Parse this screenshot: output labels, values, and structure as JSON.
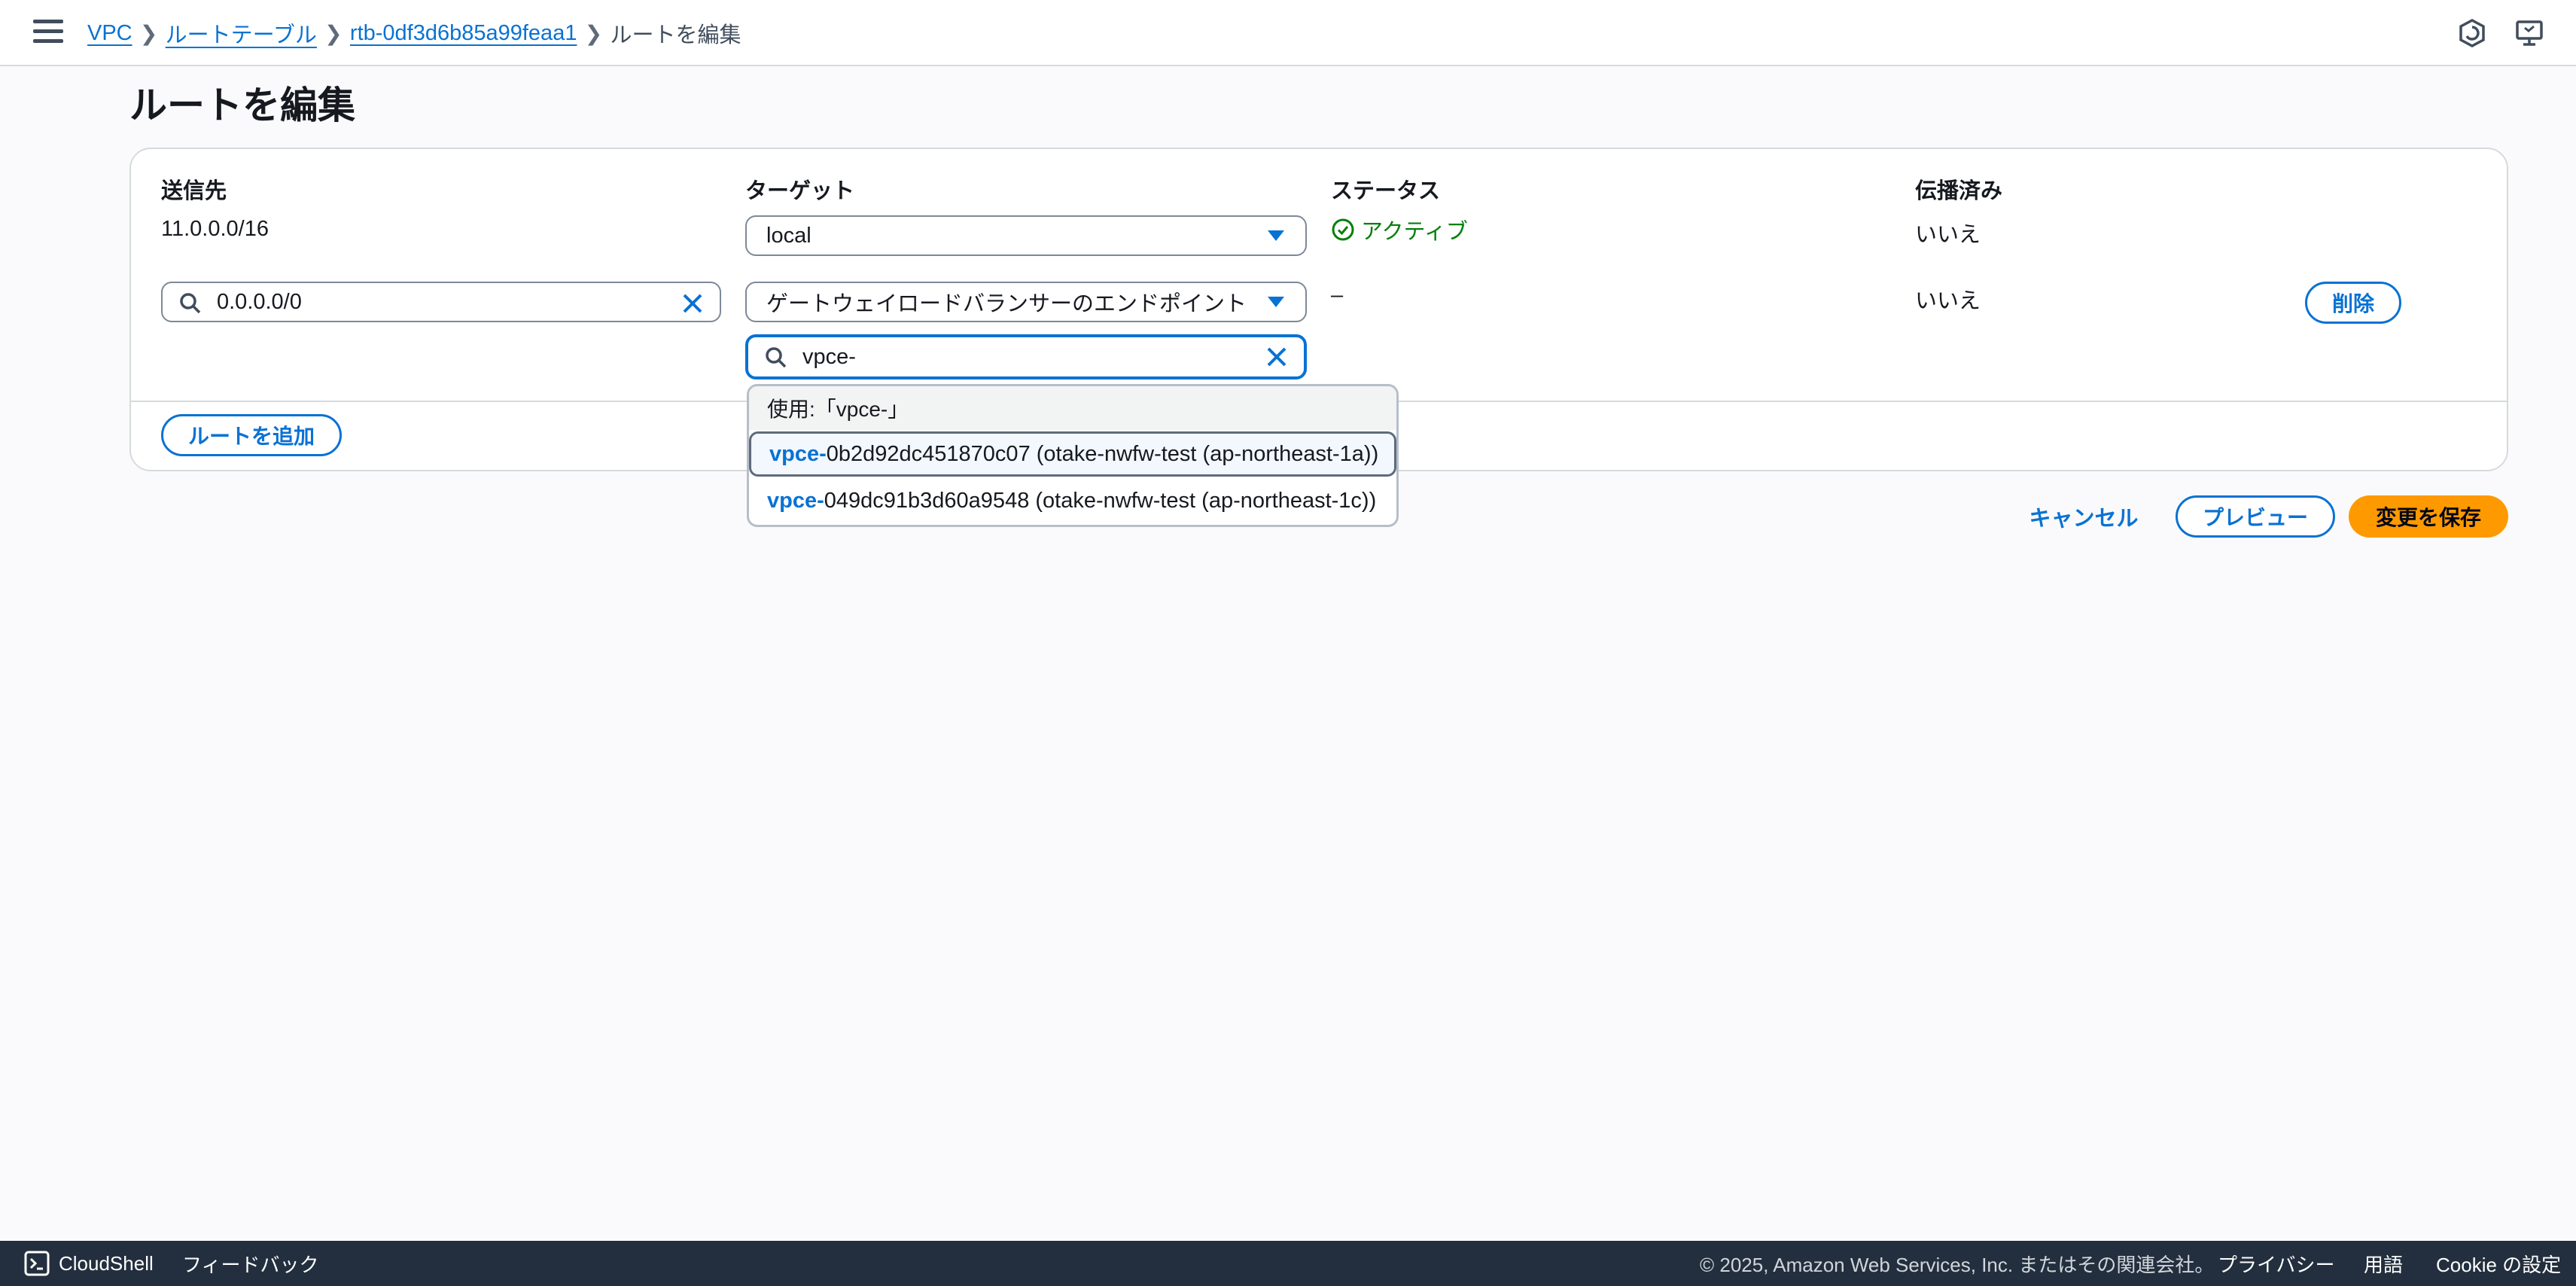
{
  "breadcrumb": {
    "items": [
      "VPC",
      "ルートテーブル",
      "rtb-0df3d6b85a99feaa1"
    ],
    "current": "ルートを編集"
  },
  "page_title": "ルートを編集",
  "columns": {
    "destination": "送信先",
    "target": "ターゲット",
    "status": "ステータス",
    "propagated": "伝播済み"
  },
  "routes": [
    {
      "destination": "11.0.0.0/16",
      "target": "local",
      "status": "アクティブ",
      "propagated": "いいえ"
    },
    {
      "destination": "0.0.0.0/0",
      "target": "ゲートウェイロードバランサーのエンドポイント",
      "target_search": "vpce-",
      "status": "–",
      "propagated": "いいえ",
      "remove_label": "削除"
    }
  ],
  "dropdown": {
    "use_label": "使用:「vpce-」",
    "options": [
      {
        "match": "vpce-",
        "rest": "0b2d92dc451870c07 (otake-nwfw-test (ap-northeast-1a))"
      },
      {
        "match": "vpce-",
        "rest": "049dc91b3d60a9548 (otake-nwfw-test (ap-northeast-1c))"
      }
    ]
  },
  "add_route_label": "ルートを追加",
  "actions": {
    "cancel": "キャンセル",
    "preview": "プレビュー",
    "save": "変更を保存"
  },
  "footer": {
    "cloudshell": "CloudShell",
    "feedback": "フィードバック",
    "copyright": "© 2025, Amazon Web Services, Inc. またはその関連会社。",
    "privacy": "プライバシー",
    "terms": "用語",
    "cookie": "Cookie の設定"
  },
  "colors": {
    "accent": "#0972d3",
    "primary_button": "#ff9900",
    "status_active": "#037f0c",
    "footer_bg": "#232f3e"
  }
}
